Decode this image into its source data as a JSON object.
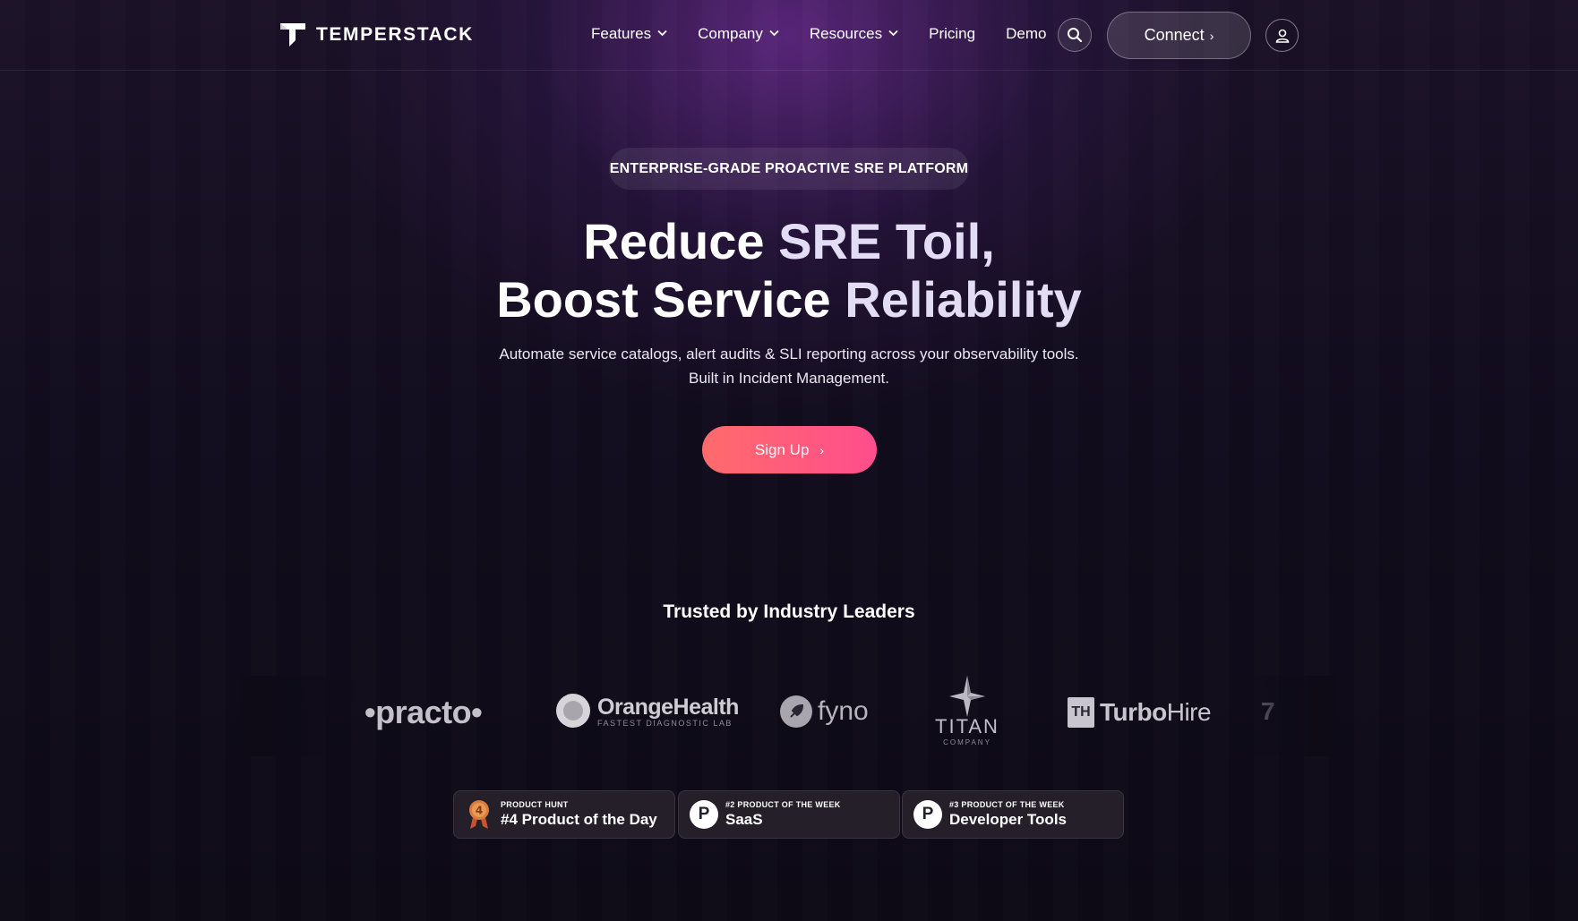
{
  "colors": {
    "accent_gradient_start": "#ff6b6b",
    "accent_gradient_end": "#ff4d8d",
    "background": "#0d0a16",
    "glow": "#6e2d96",
    "soft_text": "#e2dcf5"
  },
  "header": {
    "brand": "TEMPERSTACK",
    "nav": [
      {
        "label": "Features",
        "icon": "chevron-down-icon"
      },
      {
        "label": "Company",
        "icon": "chevron-down-icon"
      },
      {
        "label": "Resources",
        "icon": "chevron-down-icon"
      },
      {
        "label": "Pricing"
      },
      {
        "label": "Demo"
      }
    ],
    "search_icon": "search-icon",
    "connect_label": "Connect",
    "connect_arrow": "›",
    "user_icon": "user-icon"
  },
  "hero": {
    "eyebrow": "ENTERPRISE-GRADE PROACTIVE SRE PLATFORM",
    "headline_line1_a": "Reduce ",
    "headline_line1_b": "SRE Toil,",
    "headline_line2_a": "Boost Service ",
    "headline_line2_b": "Reliability",
    "subtitle_line1": "Automate service catalogs, alert audits & SLI reporting across your observability tools.",
    "subtitle_line2": "Built in Incident Management.",
    "cta_label": "Sign Up",
    "cta_arrow": "›"
  },
  "trusted": {
    "title": "Trusted by Industry Leaders",
    "logos": {
      "practo": "•practo•",
      "orange_big": "OrangeHealth",
      "orange_small": "FASTEST DIAGNOSTIC LAB",
      "fyno": "fyno",
      "titan_big": "TITAN",
      "titan_small": "COMPANY",
      "turbo_box": "TH",
      "turbo_bold": "Turbo",
      "turbo_light": "Hire",
      "peek": "7"
    }
  },
  "badges": [
    {
      "small": "PRODUCT HUNT",
      "big": "#4 Product of the Day",
      "icon": "medal-icon"
    },
    {
      "small": "#2 PRODUCT OF THE WEEK",
      "big": "SaaS",
      "icon": "product-hunt-icon",
      "glyph": "P"
    },
    {
      "small": "#3 PRODUCT OF THE WEEK",
      "big": "Developer Tools",
      "icon": "product-hunt-icon",
      "glyph": "P"
    }
  ],
  "medal_number": "4"
}
